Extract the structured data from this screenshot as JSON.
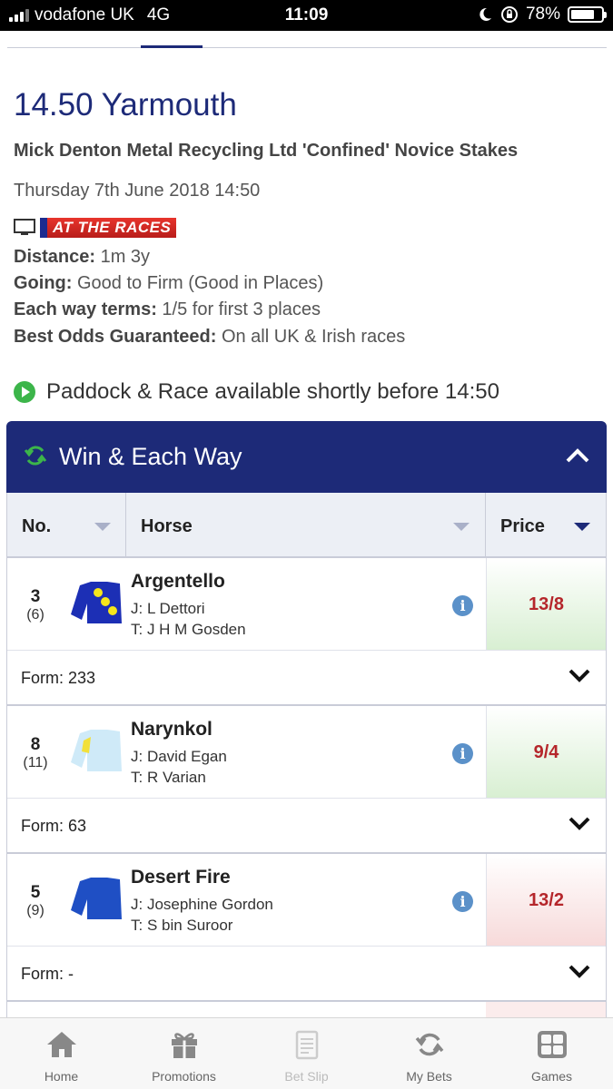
{
  "status_bar": {
    "carrier": "vodafone UK",
    "network": "4G",
    "time": "11:09",
    "battery": "78%",
    "battery_level": 0.78
  },
  "race": {
    "title": "14.50 Yarmouth",
    "name": "Mick Denton Metal Recycling Ltd 'Confined' Novice Stakes",
    "date": "Thursday 7th June 2018 14:50",
    "broadcaster": "AT THE RACES",
    "details": [
      {
        "label": "Distance:",
        "value": " 1m 3y"
      },
      {
        "label": "Going:",
        "value": " Good to Firm (Good in Places)"
      },
      {
        "label": "Each way terms:",
        "value": " 1/5 for first 3 places"
      },
      {
        "label": "Best Odds Guaranteed:",
        "value": " On all UK & Irish races"
      }
    ],
    "paddock_text": "Paddock & Race available shortly before 14:50"
  },
  "market": {
    "title": "Win & Each Way",
    "columns": {
      "no": "No.",
      "horse": "Horse",
      "price": "Price"
    },
    "runners": [
      {
        "no": "3",
        "draw": "(6)",
        "name": "Argentello",
        "jockey": "J: L Dettori",
        "trainer": "T: J H M Gosden",
        "price": "13/8",
        "form_label": "Form:",
        "form": " 233"
      },
      {
        "no": "8",
        "draw": "(11)",
        "name": "Narynkol",
        "jockey": "J: David Egan",
        "trainer": "T: R Varian",
        "price": "9/4",
        "form_label": "Form:",
        "form": " 63"
      },
      {
        "no": "5",
        "draw": "(9)",
        "name": "Desert Fire",
        "jockey": "J: Josephine Gordon",
        "trainer": "T: S bin Suroor",
        "price": "13/2",
        "form_label": "Form:",
        "form": " -"
      }
    ],
    "info_glyph": "i"
  },
  "tabbar": {
    "items": [
      {
        "label": "Home",
        "icon": "home-icon"
      },
      {
        "label": "Promotions",
        "icon": "gift-icon"
      },
      {
        "label": "Bet Slip",
        "icon": "betslip-icon"
      },
      {
        "label": "My Bets",
        "icon": "mybets-icon"
      },
      {
        "label": "Games",
        "icon": "games-icon"
      }
    ]
  },
  "colors": {
    "navy": "#1d2a78",
    "price_red": "#b5262b",
    "green": "#3cb54a"
  }
}
